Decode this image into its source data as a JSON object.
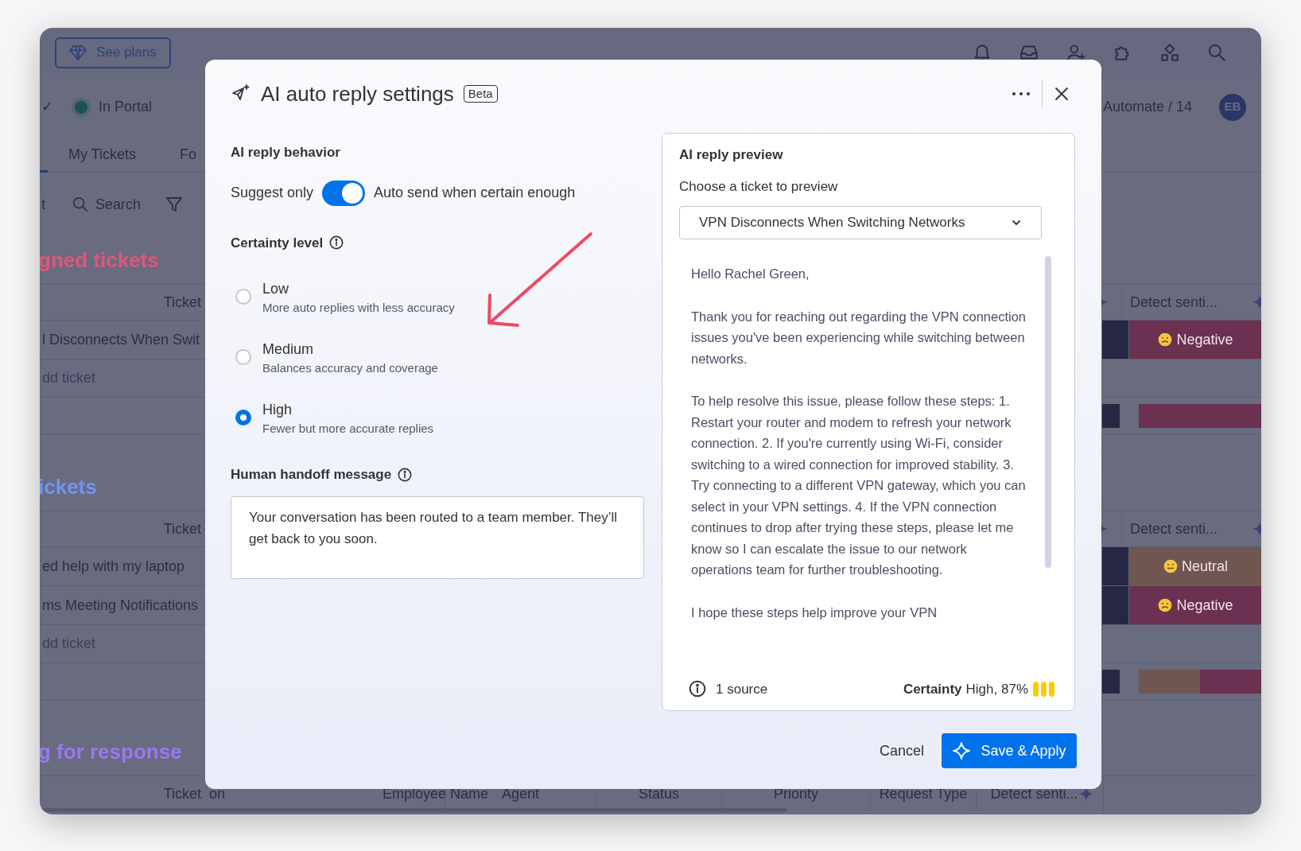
{
  "app": {
    "plans_button": "See plans",
    "fragment_mark": "✓",
    "status": "In Portal",
    "automate": "Automate / 14",
    "avatar": "EB",
    "tabs": [
      {
        "label": "My Tickets"
      },
      {
        "label": "Fo"
      }
    ],
    "toolbar": {
      "fragment": "t",
      "search": "Search"
    },
    "groups": [
      {
        "title": "gned tickets",
        "color": "#e0567a",
        "header": {
          "ticket": "Ticket",
          "detect": "Detect senti..."
        },
        "rows": [
          {
            "ticket": "l Disconnects When Swit",
            "sentiment": "Negative",
            "kind": "negative",
            "color": "#6c3050"
          }
        ],
        "add": "dd ticket",
        "summary": [
          {
            "color": "#6c3050",
            "level": 1
          }
        ]
      },
      {
        "title": "ickets",
        "color": "#6e96f0",
        "header": {
          "ticket": "Ticket",
          "detect": "Detect senti..."
        },
        "rows": [
          {
            "ticket": "ed help with my laptop",
            "sentiment": "Neutral",
            "kind": "neutral",
            "color": "#6f5650"
          },
          {
            "ticket": "ms Meeting Notifications",
            "sentiment": "Negative",
            "kind": "negative",
            "color": "#6c3050"
          }
        ],
        "add": "dd ticket",
        "summary": [
          {
            "color": "#6f5650",
            "level": 0.5
          },
          {
            "color": "#6c3050",
            "level": 0.5
          }
        ]
      },
      {
        "title": "g for response",
        "color": "#9a78f0",
        "columns": [
          "Ticket",
          "on",
          "Employee Name",
          "Agent",
          "Status",
          "Priority",
          "Request Type",
          "Detect senti..."
        ]
      }
    ]
  },
  "dialog": {
    "title": "AI auto reply settings",
    "badge": "Beta",
    "behavior": {
      "title": "AI reply behavior",
      "off_label": "Suggest only",
      "on_label": "Auto send when certain enough",
      "on": true
    },
    "certainty": {
      "title": "Certainty level",
      "options": [
        {
          "label": "Low",
          "description": "More auto replies with less accuracy",
          "selected": false
        },
        {
          "label": "Medium",
          "description": "Balances accuracy and coverage",
          "selected": false
        },
        {
          "label": "High",
          "description": "Fewer but more accurate replies",
          "selected": true
        }
      ]
    },
    "handoff": {
      "title": "Human handoff message",
      "value": "Your conversation has been routed to a team member. They’ll get back to you soon."
    },
    "preview": {
      "title": "AI reply preview",
      "choose_label": "Choose a ticket to preview",
      "ticket": "VPN Disconnects When Switching Networks",
      "message": [
        "Hello Rachel Green,",
        "Thank you for reaching out regarding the VPN connection issues you've been experiencing while switching between networks.",
        "To help resolve this issue, please follow these steps: 1. Restart your router and modem to refresh your network connection. 2. If you're currently using Wi-Fi, consider switching to a wired connection for improved stability. 3. Try connecting to a different VPN gateway, which you can select in your VPN settings. 4. If the VPN connection continues to drop after trying these steps, please let me know so I can escalate the issue to our network operations team for further troubleshooting.",
        "I hope these steps help improve your VPN"
      ],
      "sources": "1 source",
      "certainty_label": "Certainty",
      "certainty_value": "High, 87%",
      "level": 1
    },
    "buttons": {
      "cancel": "Cancel",
      "save": "Save & Apply"
    }
  }
}
